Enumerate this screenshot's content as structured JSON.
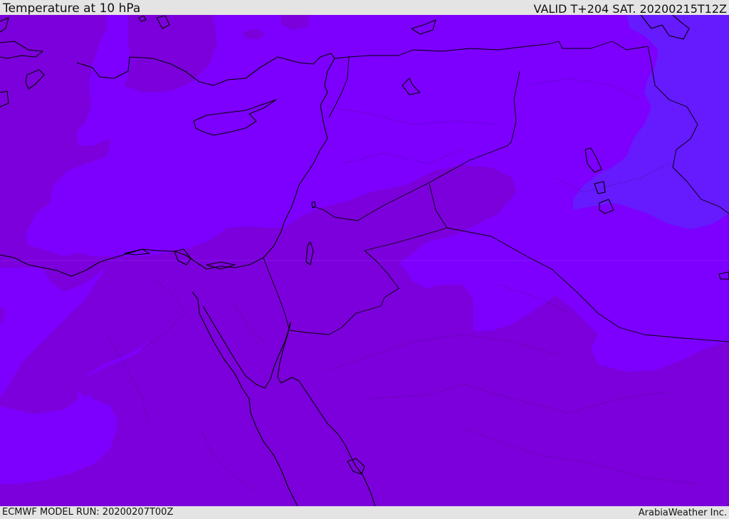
{
  "header": {
    "title": "Temperature at 10 hPa",
    "valid": "VALID T+204 SAT. 20200215T12Z"
  },
  "footer": {
    "model_run": "ECMWF MODEL RUN: 20200207T00Z",
    "credit": "ArabiaWeather Inc."
  },
  "colors": {
    "band_dark": "#7c00db",
    "band_mid": "#7d00fe",
    "band_light": "#661afe",
    "coast": "#000000"
  }
}
